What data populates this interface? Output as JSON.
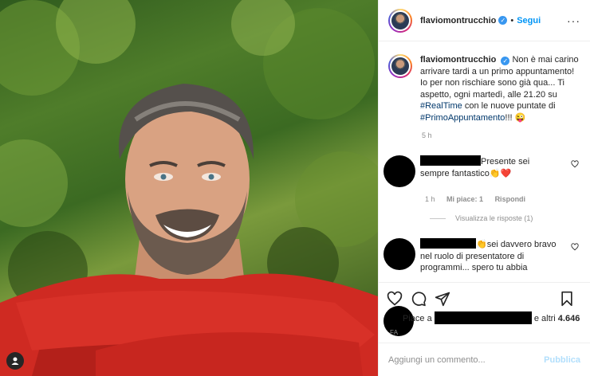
{
  "post": {
    "username": "flaviomontrucchio",
    "verified_symbol": "✓",
    "separator": "•",
    "follow_label": "Segui",
    "more_label": "···",
    "caption": {
      "username": "flaviomontrucchio",
      "text_before": "Non è mai carino arrivare tardi a un primo appuntamento! Io per non rischiare sono già qua... Ti aspetto, ogni martedì, alle 21.20 su ",
      "hashtag1": "#RealTime",
      "text_middle": " con le nuove puntate di ",
      "hashtag2": "#PrimoAppuntamento",
      "text_after": "!!! 😜",
      "time": "5 h"
    }
  },
  "comments": [
    {
      "text_line1": "Presente sei",
      "text_rest": "sempre fantastico👏❤️",
      "time": "1 h",
      "likes": "Mi piace: 1",
      "reply_label": "Rispondi",
      "view_replies": "Visualizza le risposte (1)"
    },
    {
      "text_line1": "👏sei davvero bravo",
      "text_rest": "nel ruolo di presentatore di programmi... spero tu abbia"
    }
  ],
  "likes": {
    "prefix": "Piace a",
    "suffix": "e altri",
    "count": "4.646",
    "ago": "FA"
  },
  "add_comment": {
    "placeholder": "Aggiungi un commento...",
    "publish_label": "Pubblica"
  },
  "colors": {
    "link": "#0095f6",
    "hashtag": "#00376b",
    "muted": "#8e8e8e",
    "publish_disabled": "#b2dffc"
  }
}
